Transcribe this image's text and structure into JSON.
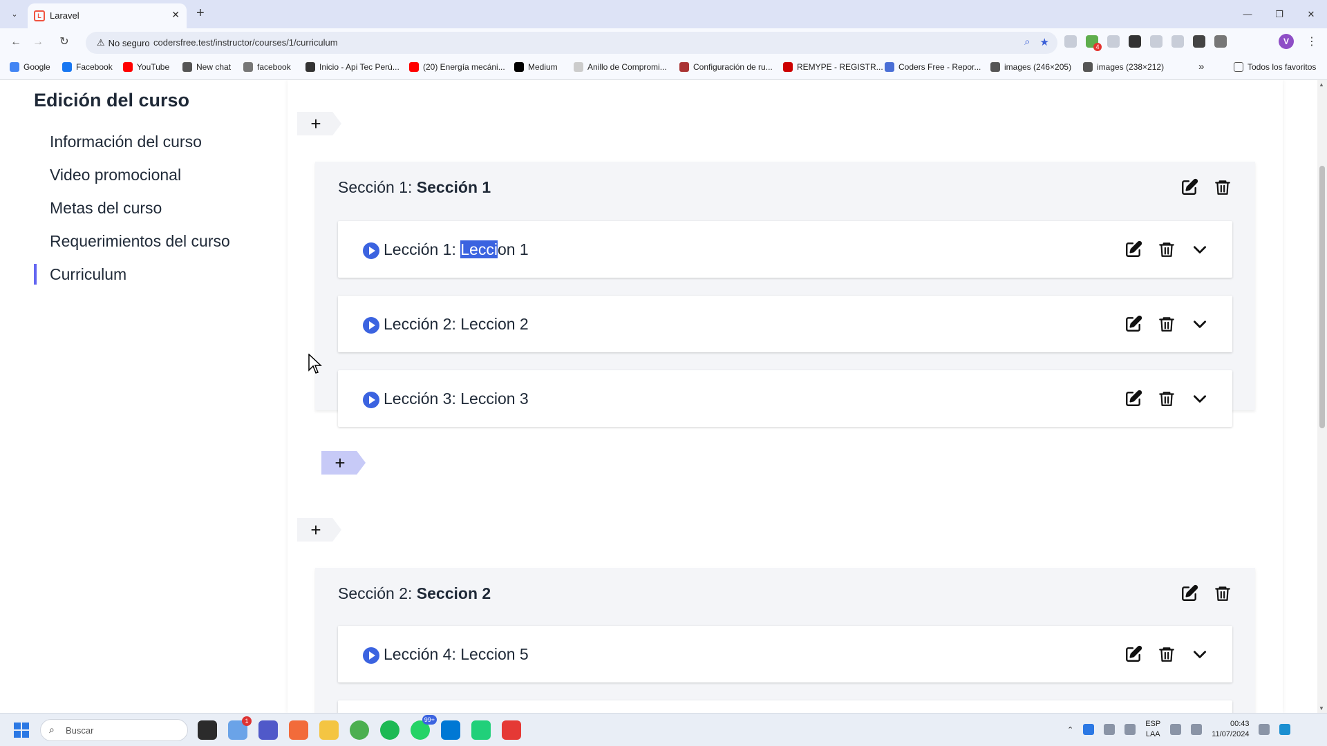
{
  "browser": {
    "tab_title": "Laravel",
    "security_label": "No seguro",
    "url": "codersfree.test/instructor/courses/1/curriculum",
    "profile_initial": "V",
    "bookmarks": [
      {
        "label": "Google",
        "color": "#4285f4"
      },
      {
        "label": "Facebook",
        "color": "#1877f2"
      },
      {
        "label": "YouTube",
        "color": "#ff0000"
      },
      {
        "label": "New chat",
        "color": "#555555"
      },
      {
        "label": "facebook",
        "color": "#777777"
      },
      {
        "label": "Inicio - Api Tec Perú...",
        "color": "#333333"
      },
      {
        "label": "(20) Energía mecáni...",
        "color": "#ff0000"
      },
      {
        "label": "Medium",
        "color": "#000000"
      },
      {
        "label": "Anillo de Compromi...",
        "color": "#cccccc"
      },
      {
        "label": "Configuración de ru...",
        "color": "#a33"
      },
      {
        "label": "REMYPE - REGISTR...",
        "color": "#c00"
      },
      {
        "label": "Coders Free - Repor...",
        "color": "#4a6fd6"
      },
      {
        "label": "images (246×205)",
        "color": "#555555"
      },
      {
        "label": "images (238×212)",
        "color": "#555555"
      }
    ],
    "all_bookmarks_label": "Todos los favoritos"
  },
  "sidebar": {
    "title": "Edición del curso",
    "items": [
      {
        "label": "Información del curso",
        "active": false
      },
      {
        "label": "Video promocional",
        "active": false
      },
      {
        "label": "Metas del curso",
        "active": false
      },
      {
        "label": "Requerimientos del curso",
        "active": false
      },
      {
        "label": "Curriculum",
        "active": true
      }
    ]
  },
  "curriculum": {
    "add_symbol": "+",
    "sections": [
      {
        "prefix": "Sección 1:",
        "name": "Sección 1",
        "lessons": [
          {
            "prefix": "Lección 1:",
            "name_selected": "Lecci",
            "name_rest": "on 1"
          },
          {
            "prefix": "Lección 2:",
            "name": "Leccion 2"
          },
          {
            "prefix": "Lección 3:",
            "name": "Leccion 3"
          }
        ]
      },
      {
        "prefix": "Sección 2:",
        "name": "Seccion 2",
        "lessons": [
          {
            "prefix": "Lección 4:",
            "name": "Leccion 5"
          }
        ]
      }
    ]
  },
  "taskbar": {
    "search_placeholder": "Buscar",
    "lang_top": "ESP",
    "lang_bottom": "LAA",
    "time": "00:43",
    "date": "11/07/2024",
    "notification_badge": "1",
    "whatsapp_badge": "99+"
  },
  "colors": {
    "accent": "#6366f1",
    "play": "#3b63e0",
    "add_tag_active": "#c7caf7"
  }
}
